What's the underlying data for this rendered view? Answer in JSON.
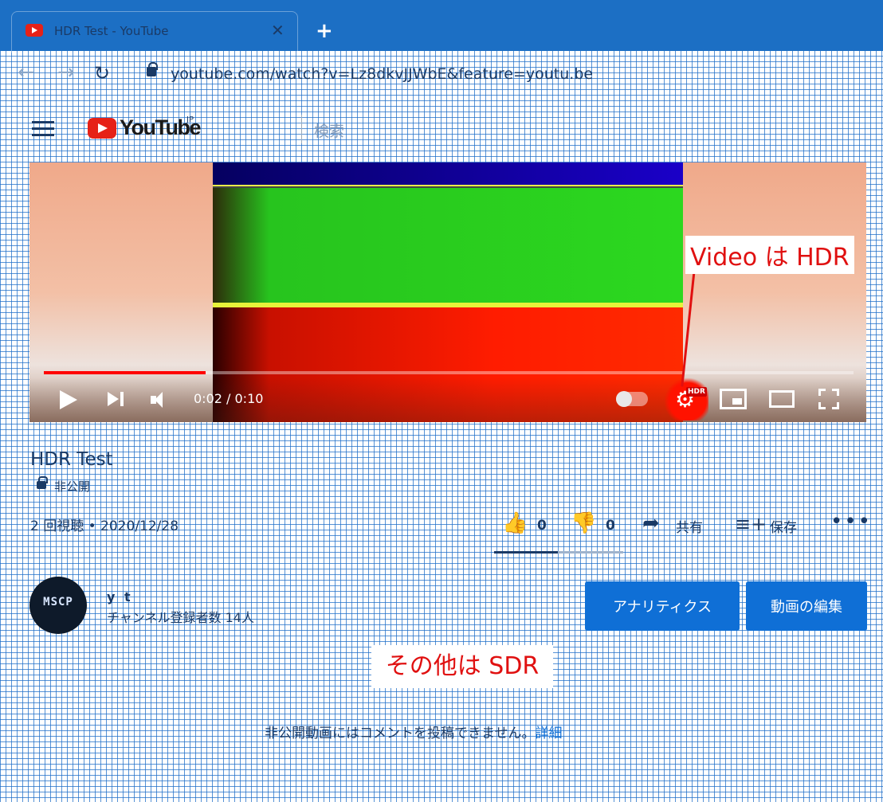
{
  "browser": {
    "tab_title": "HDR Test - YouTube",
    "close_glyph": "✕",
    "new_tab_glyph": "+",
    "back_glyph": "←",
    "forward_glyph": "→",
    "reload_glyph": "↻",
    "url": "youtube.com/watch?v=Lz8dkvJJWbE&feature=youtu.be"
  },
  "header": {
    "logo_text": "YouTube",
    "region": "JP",
    "search_placeholder": "検索"
  },
  "player": {
    "time": "0:02 / 0:10",
    "progress": 0.2,
    "hdr_badge": "HDR",
    "gear_glyph": "⚙"
  },
  "annotations": {
    "video_hdr": "Video は HDR",
    "others_sdr": "その他は SDR"
  },
  "video": {
    "title": "HDR Test",
    "privacy": "非公開",
    "meta": "2 回視聴 • 2020/12/28",
    "likes": "0",
    "dislikes": "0",
    "like_glyph": "👍",
    "dislike_glyph": "👎",
    "share_glyph": "➦",
    "save_glyph": "≡+",
    "more_glyph": "•••",
    "share_label": "共有",
    "save_label": "保存"
  },
  "channel": {
    "name": "y t",
    "subscribers": "チャンネル登録者数 14人",
    "avatar_text": "MSCP",
    "analytics_label": "アナリティクス",
    "edit_label": "動画の編集"
  },
  "comments": {
    "note": "非公開動画にはコメントを投稿できません。",
    "link": "詳細"
  },
  "colors": {
    "chrome": "#1c6fc4",
    "youtube_red": "#e62117",
    "annotation_red": "#e01010",
    "button_blue": "#0f6fd6"
  }
}
